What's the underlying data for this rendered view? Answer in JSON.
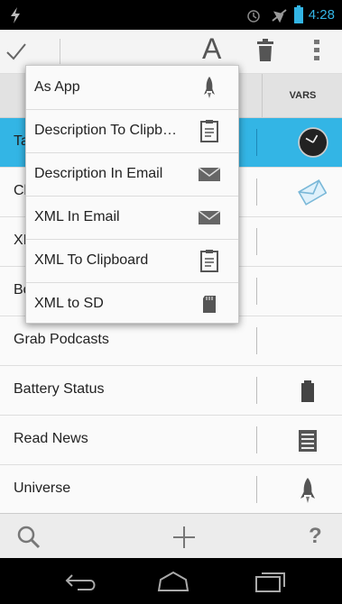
{
  "status": {
    "time": "4:28"
  },
  "actionbar": {
    "font_letter": "A"
  },
  "tabs": {
    "vars": "VARS"
  },
  "list": {
    "rows": [
      {
        "label": "Ta",
        "icon": "clock-icon"
      },
      {
        "label": "Cl",
        "icon": "envelope-icon"
      },
      {
        "label": "XI",
        "icon": ""
      },
      {
        "label": "Bo",
        "icon": ""
      },
      {
        "label": "Grab Podcasts",
        "icon": ""
      },
      {
        "label": "Battery Status",
        "icon": "battery-icon"
      },
      {
        "label": "Read News",
        "icon": "news-icon"
      },
      {
        "label": "Universe",
        "icon": "rocket-icon"
      }
    ]
  },
  "menu": {
    "items": [
      {
        "label": "As App",
        "icon": "rocket-icon"
      },
      {
        "label": "Description To Clipb…",
        "icon": "clipboard-icon"
      },
      {
        "label": "Description In Email",
        "icon": "email-icon"
      },
      {
        "label": "XML In Email",
        "icon": "email-icon"
      },
      {
        "label": "XML To Clipboard",
        "icon": "clipboard-icon"
      },
      {
        "label": "XML to SD",
        "icon": "sdcard-icon"
      }
    ]
  },
  "bottombar": {
    "help": "?"
  },
  "colors": {
    "accent": "#33b5e5",
    "background": "#f2f2f2"
  }
}
